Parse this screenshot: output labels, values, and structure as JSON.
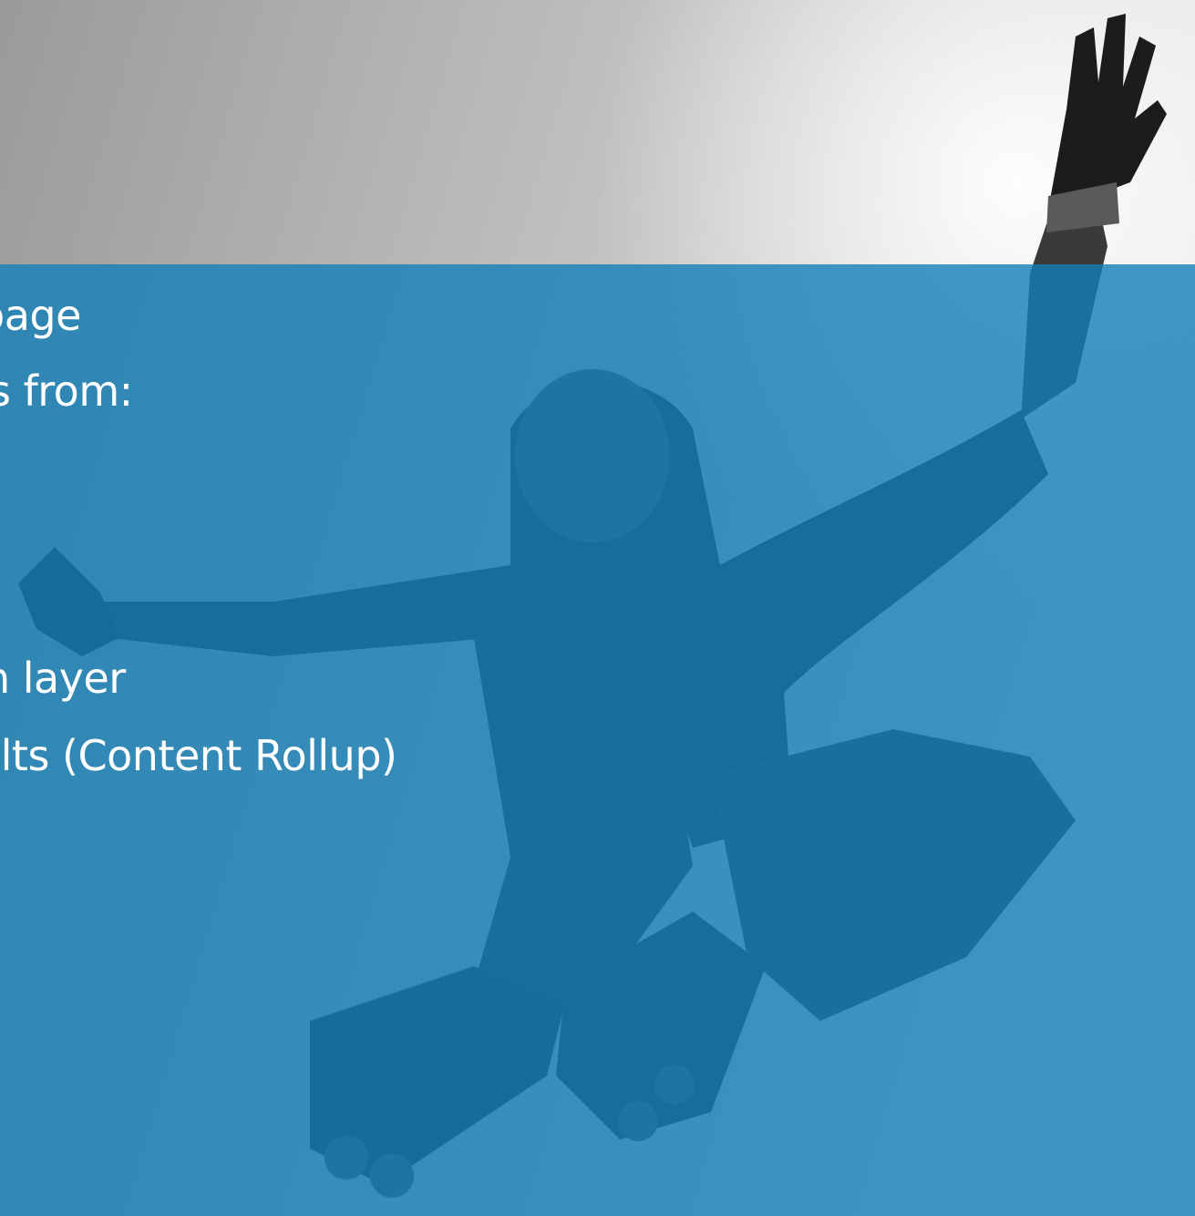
{
  "slide": {
    "lines": [
      "page",
      "s from:",
      "n layer",
      "ults (Content Rollup)"
    ]
  },
  "colors": {
    "overlay": "#1480b8",
    "sky": "#bdbdbd",
    "text": "#ffffff"
  },
  "image": {
    "subject": "inline-skater-jumping-photo"
  }
}
